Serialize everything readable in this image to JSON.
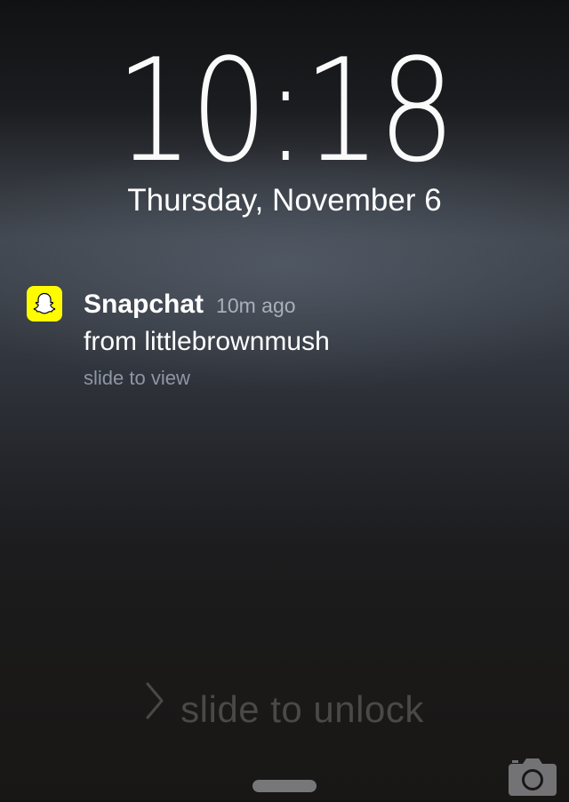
{
  "lock_screen": {
    "time": "10:18",
    "date": "Thursday, November 6"
  },
  "notification": {
    "app_name": "Snapchat",
    "time_ago": "10m ago",
    "message": "from littlebrownmush",
    "action_hint": "slide to view",
    "icon": "snapchat-ghost-icon",
    "icon_color": "#FFFC00"
  },
  "unlock": {
    "label": "slide to unlock",
    "icon": "chevron-right-icon"
  },
  "bottom": {
    "grabber": "control-center-grabber",
    "camera_icon": "camera-icon"
  }
}
